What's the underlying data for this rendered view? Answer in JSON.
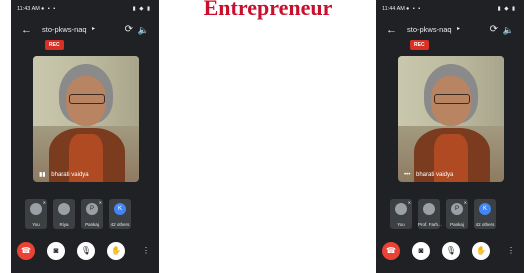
{
  "slide": {
    "title": "Entrepreneur"
  },
  "phones": [
    {
      "status_time": "11:43 AM",
      "meeting_code": "sto-pkws-naq",
      "rec_label": "REC",
      "presenter_name": "bharati vaidya",
      "tiles": [
        {
          "label": "You",
          "avatar": ""
        },
        {
          "label": "Riya",
          "avatar": ""
        },
        {
          "label": "Pankaj",
          "avatar": "P"
        },
        {
          "label": "42 others",
          "avatar": "K"
        }
      ]
    },
    {
      "status_time": "11:44 AM",
      "meeting_code": "sto-pkws-naq",
      "rec_label": "REC",
      "presenter_name": "bharati vaidya",
      "tiles": [
        {
          "label": "You",
          "avatar": ""
        },
        {
          "label": "Prof. Farh...",
          "avatar": ""
        },
        {
          "label": "Pankaj",
          "avatar": "P"
        },
        {
          "label": "42 others",
          "avatar": "K"
        }
      ]
    }
  ],
  "colors": {
    "call_bg": "#202124",
    "end_call": "#ea4335",
    "rec": "#d93025",
    "title": "#c8102e"
  },
  "icons": {
    "back": "arrow-left-icon",
    "rotate": "switch-camera-icon",
    "audio": "speaker-icon",
    "end": "end-call-icon",
    "video_off": "video-off-icon",
    "mic_off": "mic-off-icon",
    "hand": "raise-hand-icon",
    "more": "more-options-icon"
  }
}
